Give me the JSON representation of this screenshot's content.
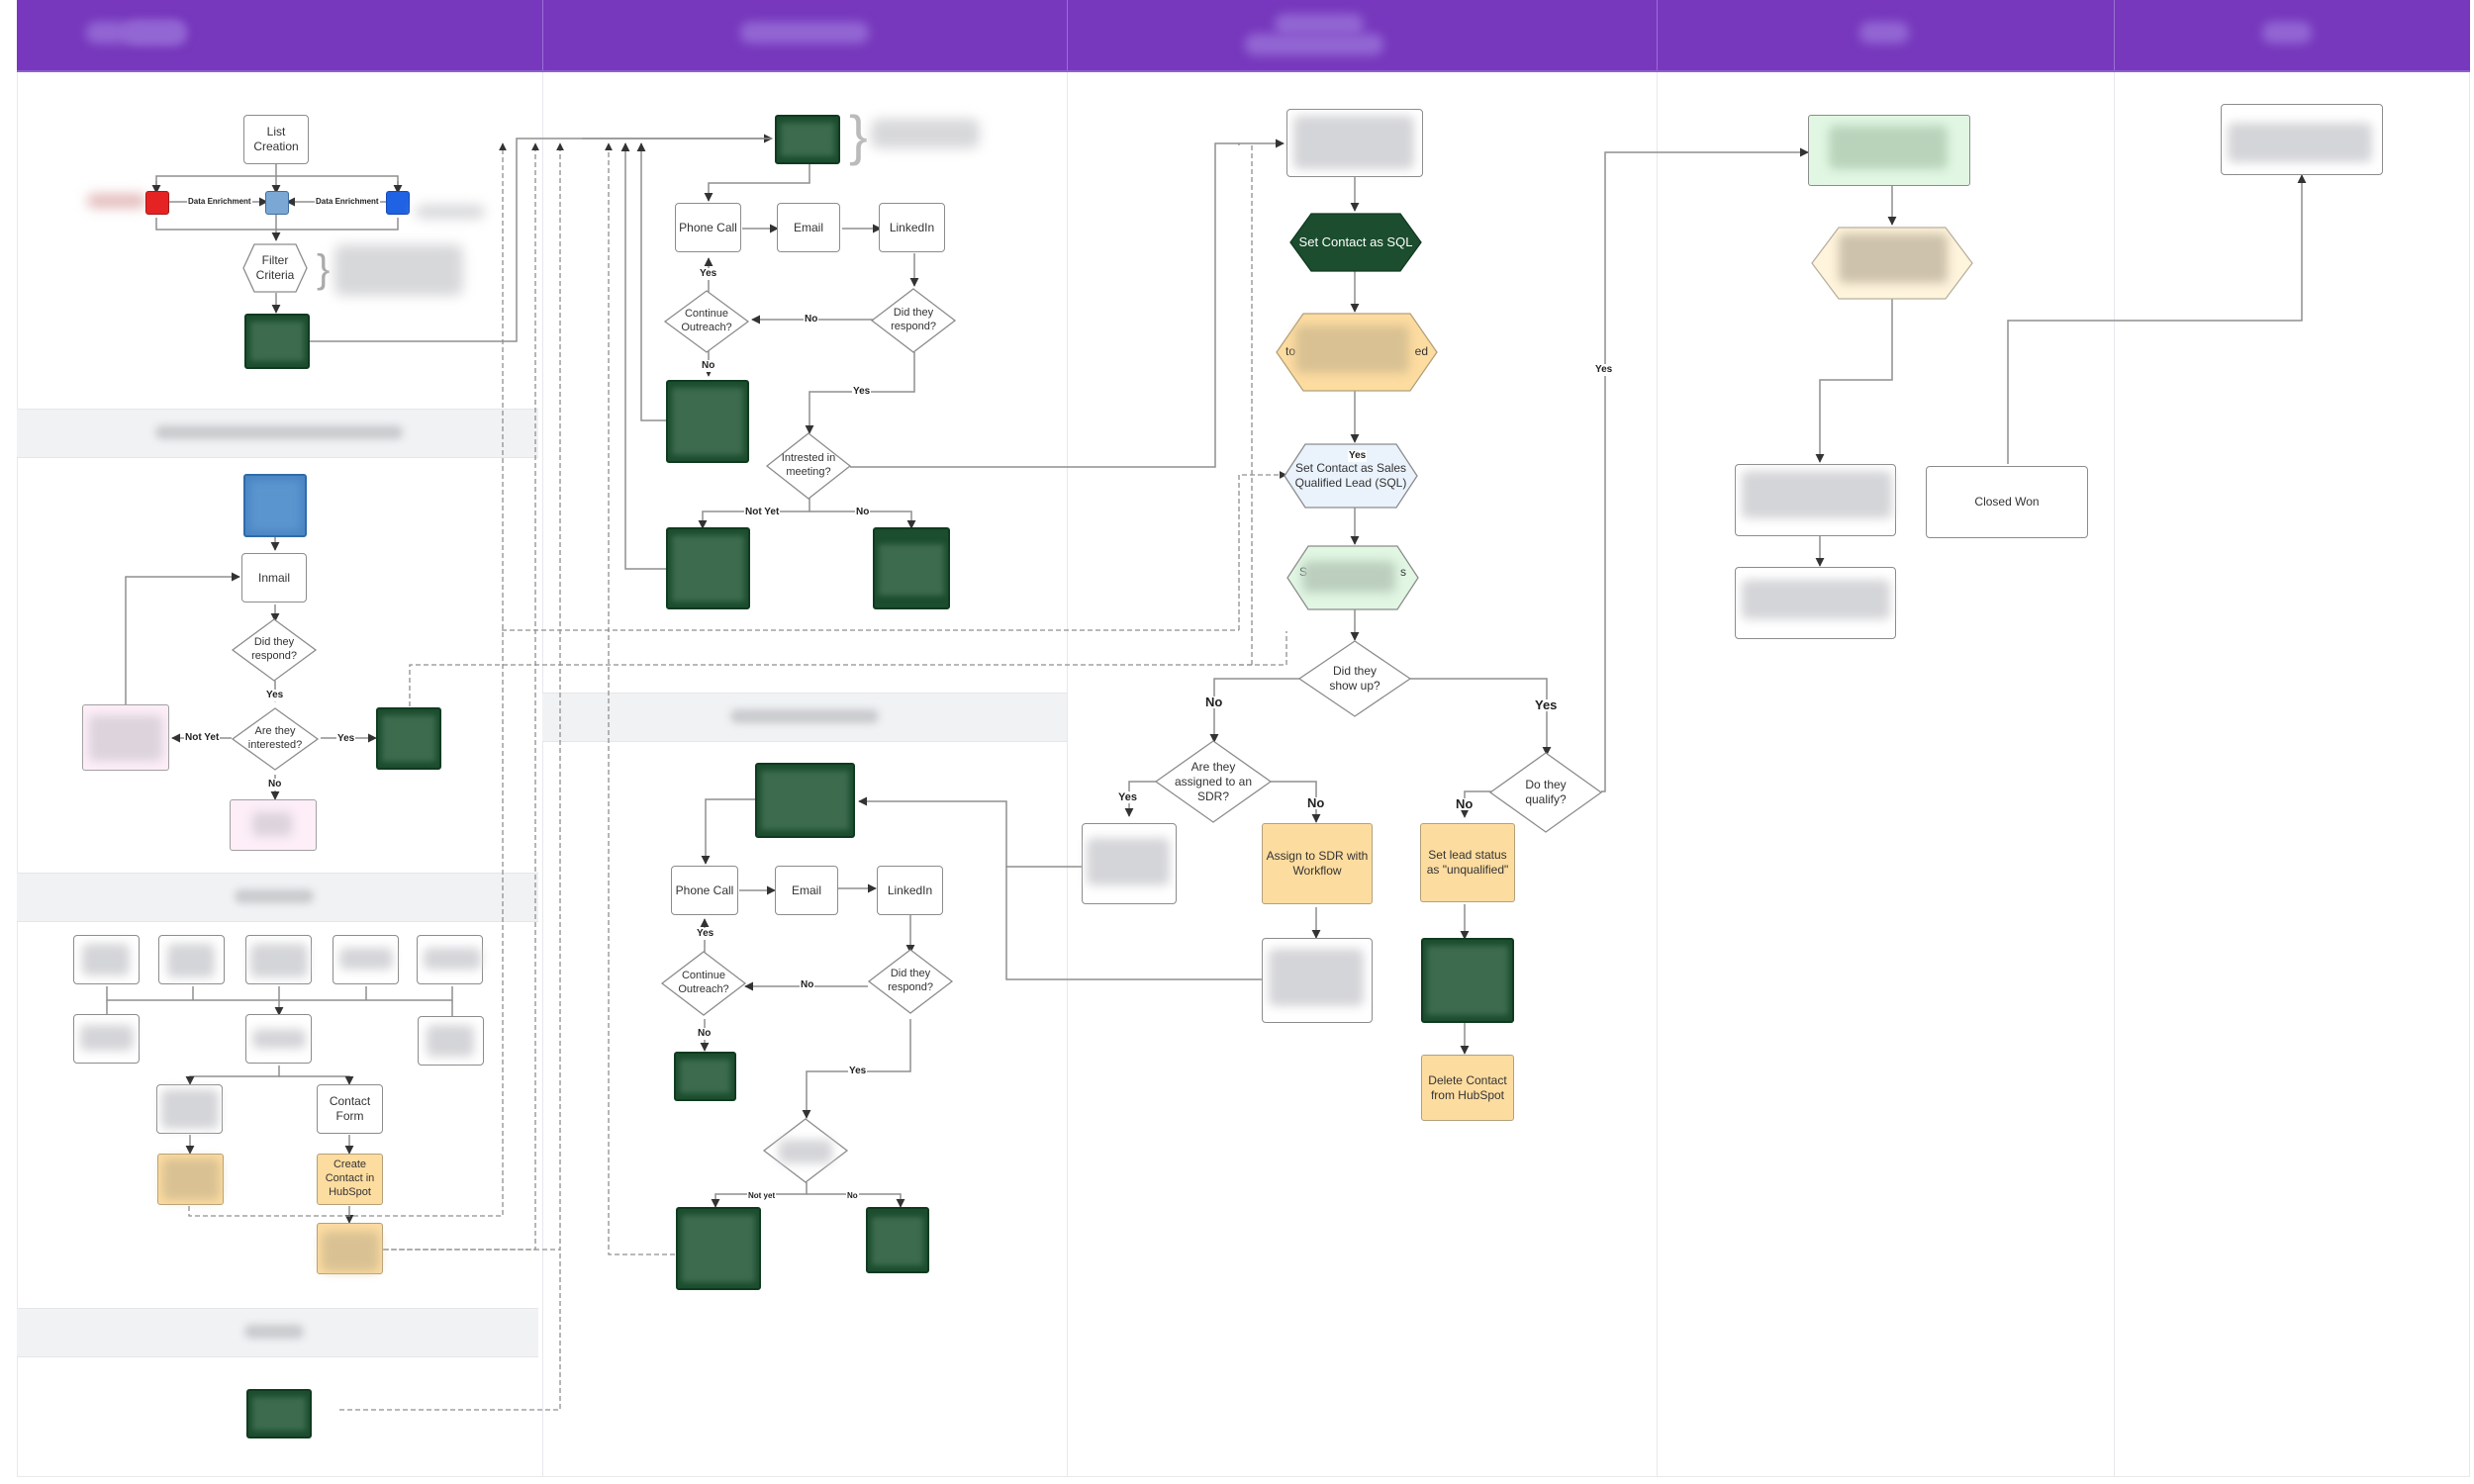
{
  "header": {
    "lanes": [
      {
        "id": "lane-1",
        "title": "[redacted]"
      },
      {
        "id": "lane-2",
        "title": "[redacted]"
      },
      {
        "id": "lane-3",
        "title": "[redacted]"
      },
      {
        "id": "lane-4",
        "title": "[redacted]"
      },
      {
        "id": "lane-5",
        "title": "[redacted]"
      }
    ]
  },
  "colors": {
    "header": "#7738bd",
    "task_green": "#1b4d2e",
    "hubspot_orange": "#fddca0",
    "sql_blue": "#eaf2fc",
    "meeting_green": "#e1f7e3",
    "lane_band": "#f1f2f4"
  },
  "lane1": {
    "list_creation": "List Creation",
    "data_enrichment_left": "Data Enrichment",
    "data_enrichment_right": "Data Enrichment",
    "filter_criteria": "Filter Criteria",
    "inmail": "Inmail",
    "did_they_respond": "Did they respond?",
    "are_they_interested": "Are they interested?",
    "edge_yes_1": "Yes",
    "edge_not_yet": "Not Yet",
    "edge_yes_2": "Yes",
    "edge_no": "No",
    "contact_form": "Contact Form",
    "create_contact": "Create Contact in HubSpot"
  },
  "lane2": {
    "top": {
      "phone_call": "Phone Call",
      "email": "Email",
      "linkedin": "LinkedIn",
      "continue_outreach": "Continue Outreach?",
      "did_they_respond": "Did they respond?",
      "interested_in_meeting": "Intrested in meeting?",
      "edge_yes": "Yes",
      "edge_no": "No",
      "edge_no_down": "No",
      "edge_yes_down": "Yes",
      "edge_not_yet": "Not Yet",
      "edge_no_right": "No"
    },
    "bottom": {
      "phone_call": "Phone Call",
      "email": "Email",
      "linkedin": "LinkedIn",
      "continue_outreach": "Continue Outreach?",
      "did_they_respond": "Did they respond?",
      "edge_yes": "Yes",
      "edge_no": "No",
      "edge_no_down": "No",
      "edge_yes_down": "Yes",
      "edge_not_yet": "Not yet",
      "edge_no_right": "No"
    }
  },
  "lane3": {
    "set_contact_sql": "Set Contact as SQL",
    "orange_hex_partial_left": "to",
    "orange_hex_partial_right": "ed",
    "set_contact_sales_qualified": "Set Contact as Sales Qualified Lead (SQL)",
    "green_hex_partial_left": "S",
    "green_hex_partial_right": "s",
    "did_they_show_up": "Did they show up?",
    "are_they_assigned": "Are they assigned to an SDR?",
    "do_they_qualify": "Do they qualify?",
    "assign_sdr": "Assign to SDR with Workflow",
    "set_unqualified": "Set lead status as \"unqualified\"",
    "delete_contact": "Delete Contact from HubSpot",
    "edge_yes_in": "Yes",
    "edge_no_left": "No",
    "edge_yes_right": "Yes",
    "edge_yes_sdr": "Yes",
    "edge_no_sdr": "No",
    "edge_no_qualify": "No",
    "edge_yes_qualify": "Yes"
  },
  "lane4": {
    "closed_won": "Closed Won"
  }
}
